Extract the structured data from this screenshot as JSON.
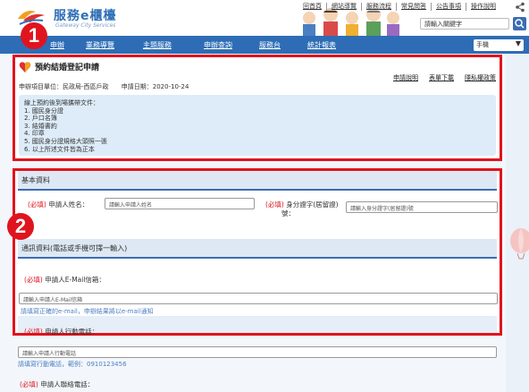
{
  "header": {
    "logo_text": "服務e櫃檯",
    "logo_sub": "Gateway City Services",
    "top_links": [
      "回首頁",
      "網站導覽",
      "服務流程",
      "常見問答",
      "公告事項",
      "操作說明"
    ],
    "search_placeholder": "請輸入關鍵字"
  },
  "nav": {
    "items": [
      "申辦",
      "業務導覽",
      "主題服務",
      "申辦查詢",
      "服務台",
      "統計報表"
    ],
    "select_label": "手機"
  },
  "section1": {
    "badge": "1",
    "title": "預約結婚登記申請",
    "help_links": [
      "申請說明",
      "表單下載",
      "隱私權政策"
    ],
    "unit_label": "申辦項目單位：民政局-西區戶政",
    "date_label": "申請日期：2020-10-24",
    "notice_lines": [
      "線上預約後到場攜帶文件：",
      "1. 國民身分證",
      "2. 戶口名簿",
      "3. 結婚書約",
      "4. 印章",
      "5. 國民身分證規格大頭照一張",
      "6. 以上所述文件皆為正本"
    ]
  },
  "section2": {
    "badge": "2",
    "basic_title": "基本資料",
    "required_tag": "(必填)",
    "name_label": "申請人姓名：",
    "name_placeholder": "請輸入申請人姓名",
    "id_label": "身分證字(居留證)",
    "id_label2": "號：",
    "id_placeholder": "請輸入身分證字(居留證)號",
    "contact_title": "通訊資料(電話或手機可擇一輸入)",
    "email_label": "申請人E-Mail信箱：",
    "email_placeholder": "請輸入申請人E-Mail信箱",
    "email_hint": "請填寫正確的e-mail，申辦結果將以e-mail通知",
    "mobile_label": "申請人行動電話："
  },
  "below": {
    "mobile_placeholder": "請輸入申請人行動電話",
    "mobile_hint": "請填寫行動電話，範例：0910123456",
    "phone_label": "申請人聯絡電話："
  },
  "colors": {
    "nav_bg": "#2e6db5",
    "highlight_border": "#e0141e",
    "notice_bg": "#ddecf8"
  }
}
